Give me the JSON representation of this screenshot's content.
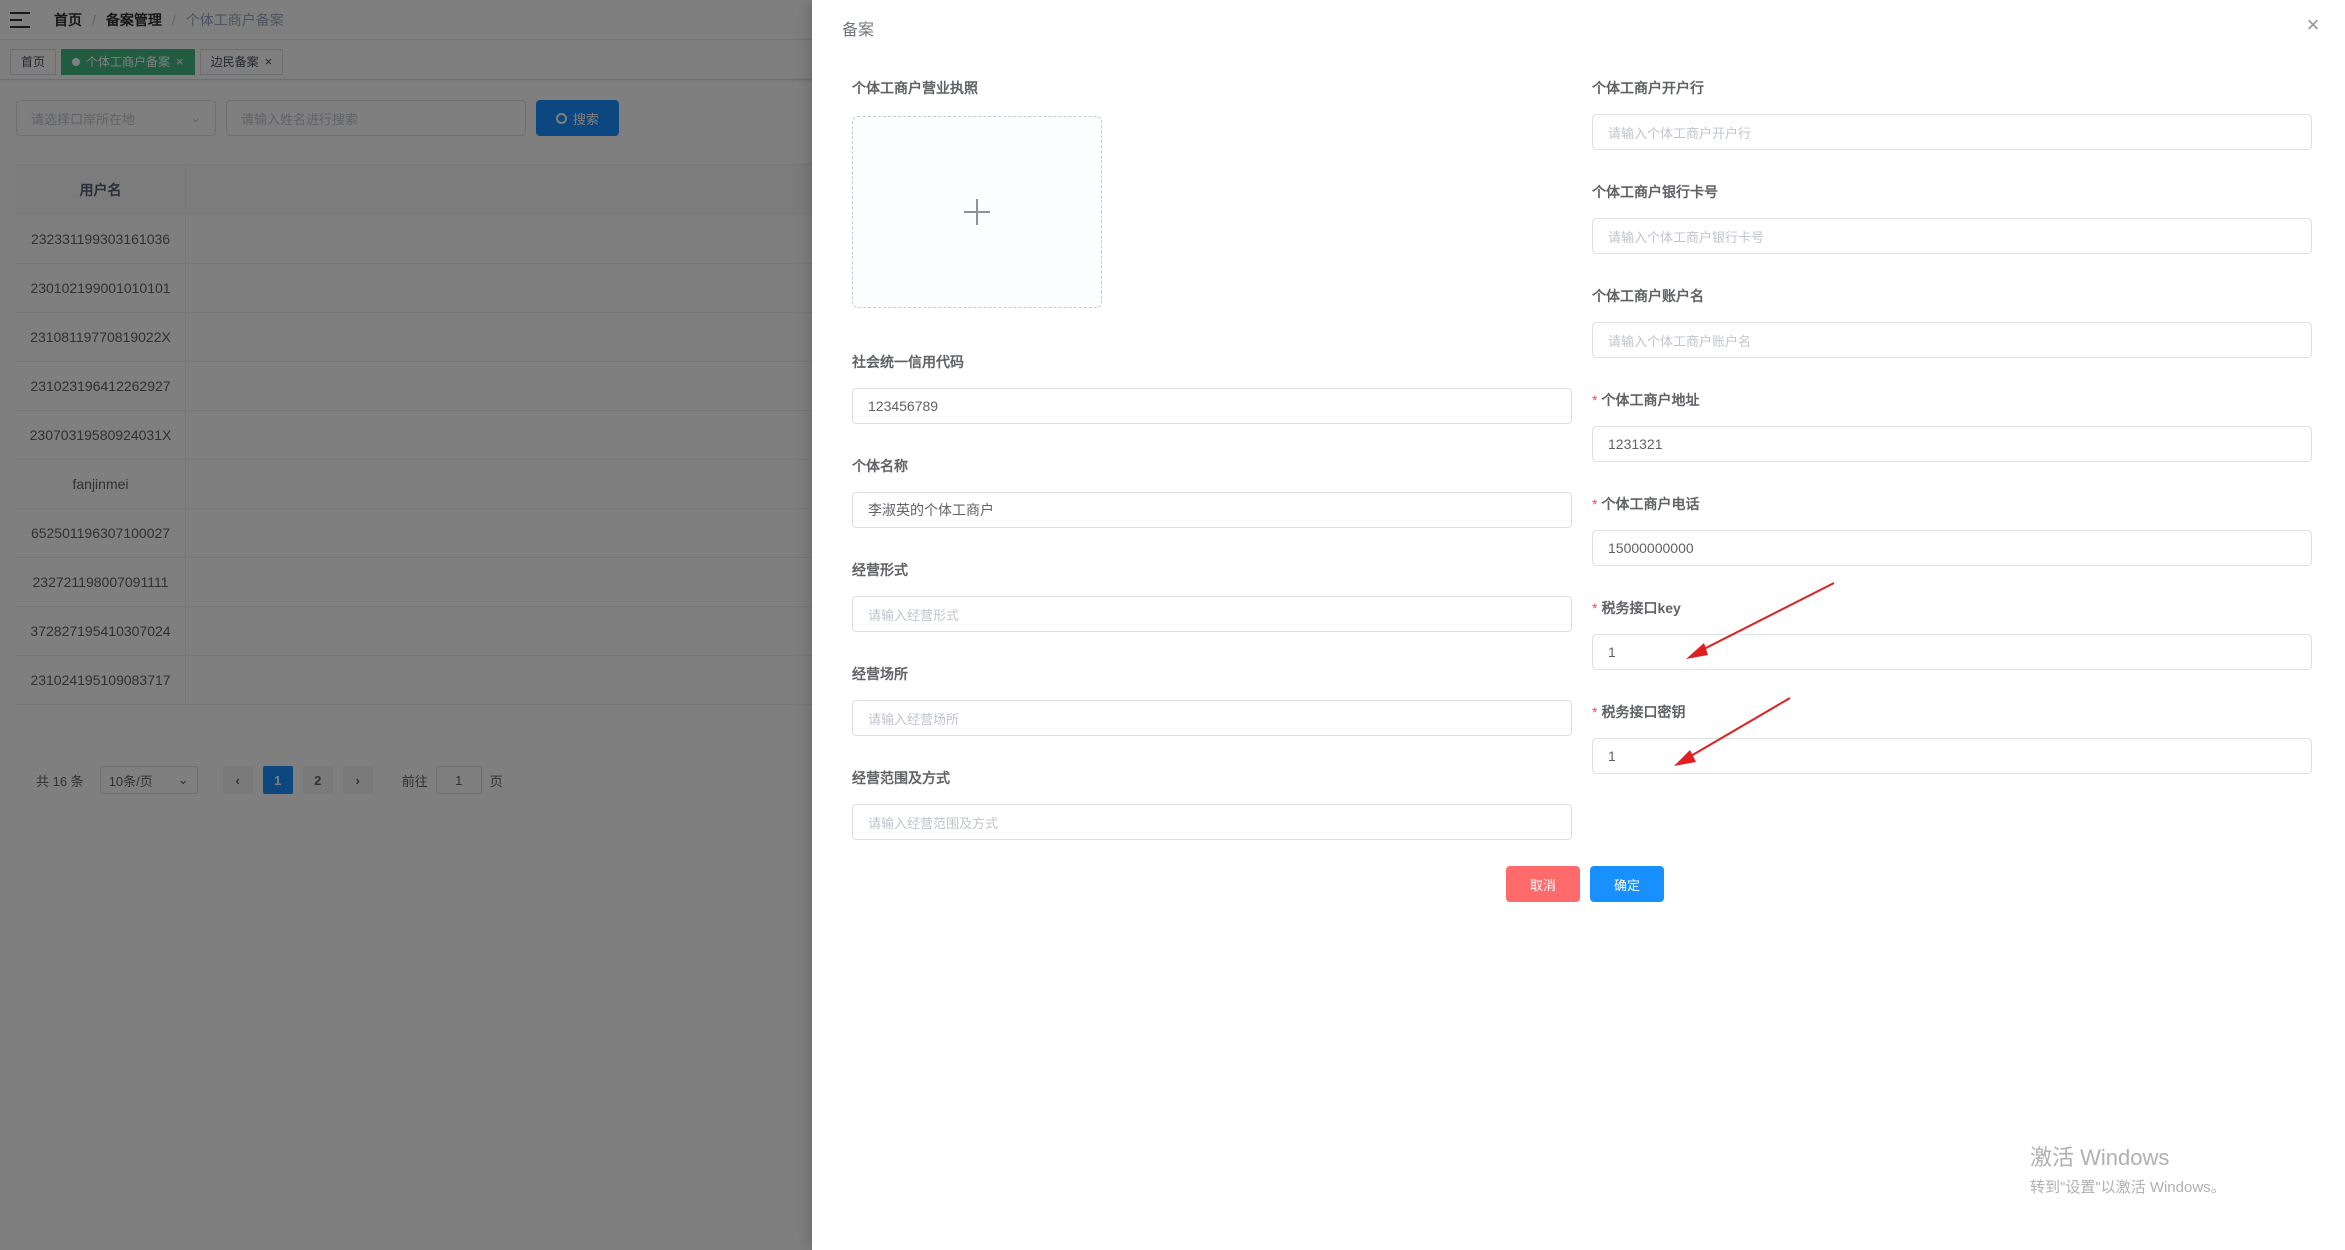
{
  "navbar": {
    "breadcrumbs": [
      "首页",
      "备案管理",
      "个体工商户备案"
    ]
  },
  "tags": [
    {
      "label": "首页",
      "active": false
    },
    {
      "label": "个体工商户备案",
      "active": true
    },
    {
      "label": "边民备案",
      "active": false
    }
  ],
  "filters": {
    "port_placeholder": "请选择口岸所在地",
    "name_placeholder": "请输入姓名进行搜索",
    "search_label": "搜索"
  },
  "table": {
    "header": "用户名",
    "rows": [
      "232331199303161036",
      "230102199001010101",
      "23108119770819022X",
      "231023196412262927",
      "23070319580924031X",
      "fanjinmei",
      "652501196307100027",
      "232721198007091111",
      "372827195410307024",
      "231024195109083717"
    ]
  },
  "pagination": {
    "total": "共 16 条",
    "page_size": "10条/页",
    "pages": [
      "1",
      "2"
    ],
    "current": "1",
    "goto_prefix": "前往",
    "goto_value": "1",
    "goto_suffix": "页"
  },
  "drawer": {
    "title": "备案",
    "close": "×",
    "left_fields": {
      "license": {
        "label": "个体工商户营业执照"
      },
      "credit_code": {
        "label": "社会统一信用代码",
        "value": "123456789"
      },
      "name": {
        "label": "个体名称",
        "value": "李淑英的个体工商户"
      },
      "form": {
        "label": "经营形式",
        "placeholder": "请输入经营形式"
      },
      "place": {
        "label": "经营场所",
        "placeholder": "请输入经营场所"
      },
      "scope": {
        "label": "经营范围及方式",
        "placeholder": "请输入经营范围及方式"
      }
    },
    "right_fields": {
      "bank": {
        "label": "个体工商户开户行",
        "placeholder": "请输入个体工商户开户行"
      },
      "card": {
        "label": "个体工商户银行卡号",
        "placeholder": "请输入个体工商户银行卡号"
      },
      "account": {
        "label": "个体工商户账户名",
        "placeholder": "请输入个体工商户账户名"
      },
      "address": {
        "label": "个体工商户地址",
        "value": "1231321",
        "required": "*"
      },
      "phone": {
        "label": "个体工商户电话",
        "value": "15000000000",
        "required": "*"
      },
      "tax_key": {
        "label": "税务接口key",
        "value": "1",
        "required": "*"
      },
      "tax_secret": {
        "label": "税务接口密钥",
        "value": "1",
        "required": "*"
      }
    },
    "cancel_label": "取消",
    "confirm_label": "确定"
  },
  "watermark": {
    "line1": "激活 Windows",
    "line2": "转到\"设置\"以激活 Windows。"
  },
  "colors": {
    "primary": "#1890ff",
    "danger": "#ff6b6b",
    "tag_active": "#42b983",
    "required": "#ff4949",
    "annotation_arrow": "#e02020"
  }
}
